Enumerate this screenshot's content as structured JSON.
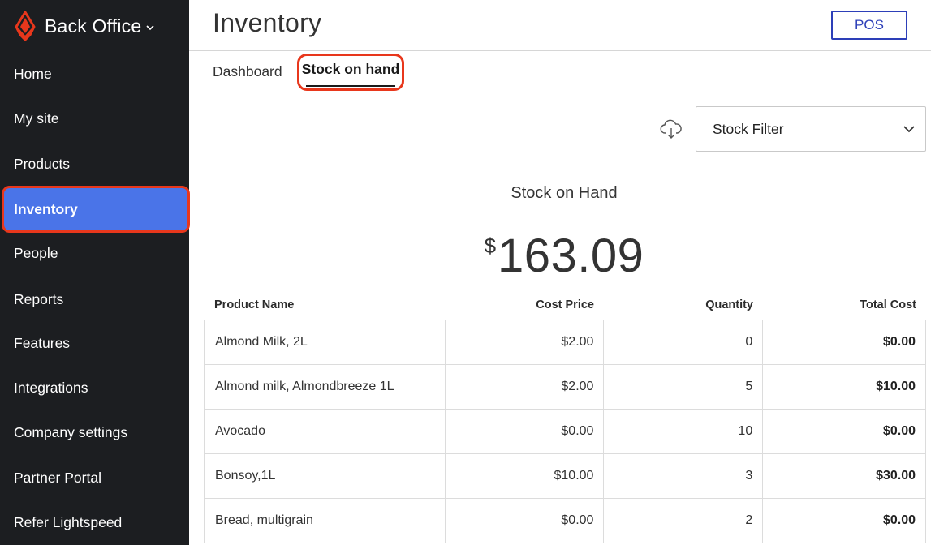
{
  "sidebar": {
    "brand": {
      "label": "Back Office"
    },
    "items": [
      {
        "label": "Home"
      },
      {
        "label": "My site"
      },
      {
        "label": "Products"
      },
      {
        "label": "Inventory"
      },
      {
        "label": "People"
      },
      {
        "label": "Reports"
      },
      {
        "label": "Features"
      },
      {
        "label": "Integrations"
      },
      {
        "label": "Company settings"
      },
      {
        "label": "Partner Portal"
      },
      {
        "label": "Refer Lightspeed"
      }
    ],
    "active_index": 3
  },
  "header": {
    "title": "Inventory",
    "pos_label": "POS"
  },
  "tabs": [
    {
      "label": "Dashboard"
    },
    {
      "label": "Stock on hand"
    }
  ],
  "toolbar": {
    "download_icon": "cloud-download-icon",
    "filter_label": "Stock Filter"
  },
  "summary": {
    "label": "Stock on Hand",
    "currency": "$",
    "amount": "163.09"
  },
  "table": {
    "columns": [
      "Product Name",
      "Cost Price",
      "Quantity",
      "Total Cost"
    ],
    "rows": [
      {
        "name": "Almond Milk, 2L",
        "cost": "$2.00",
        "qty": "0",
        "total": "$0.00"
      },
      {
        "name": "Almond milk, Almondbreeze 1L",
        "cost": "$2.00",
        "qty": "5",
        "total": "$10.00"
      },
      {
        "name": "Avocado",
        "cost": "$0.00",
        "qty": "10",
        "total": "$0.00"
      },
      {
        "name": "Bonsoy,1L",
        "cost": "$10.00",
        "qty": "3",
        "total": "$30.00"
      },
      {
        "name": "Bread, multigrain",
        "cost": "$0.00",
        "qty": "2",
        "total": "$0.00"
      }
    ]
  },
  "colors": {
    "sidebar_bg": "#1c1e21",
    "active_bg": "#4a74e8",
    "highlight": "#e8371c",
    "brand_red": "#e8371c",
    "pos_blue": "#2d3fb8"
  }
}
